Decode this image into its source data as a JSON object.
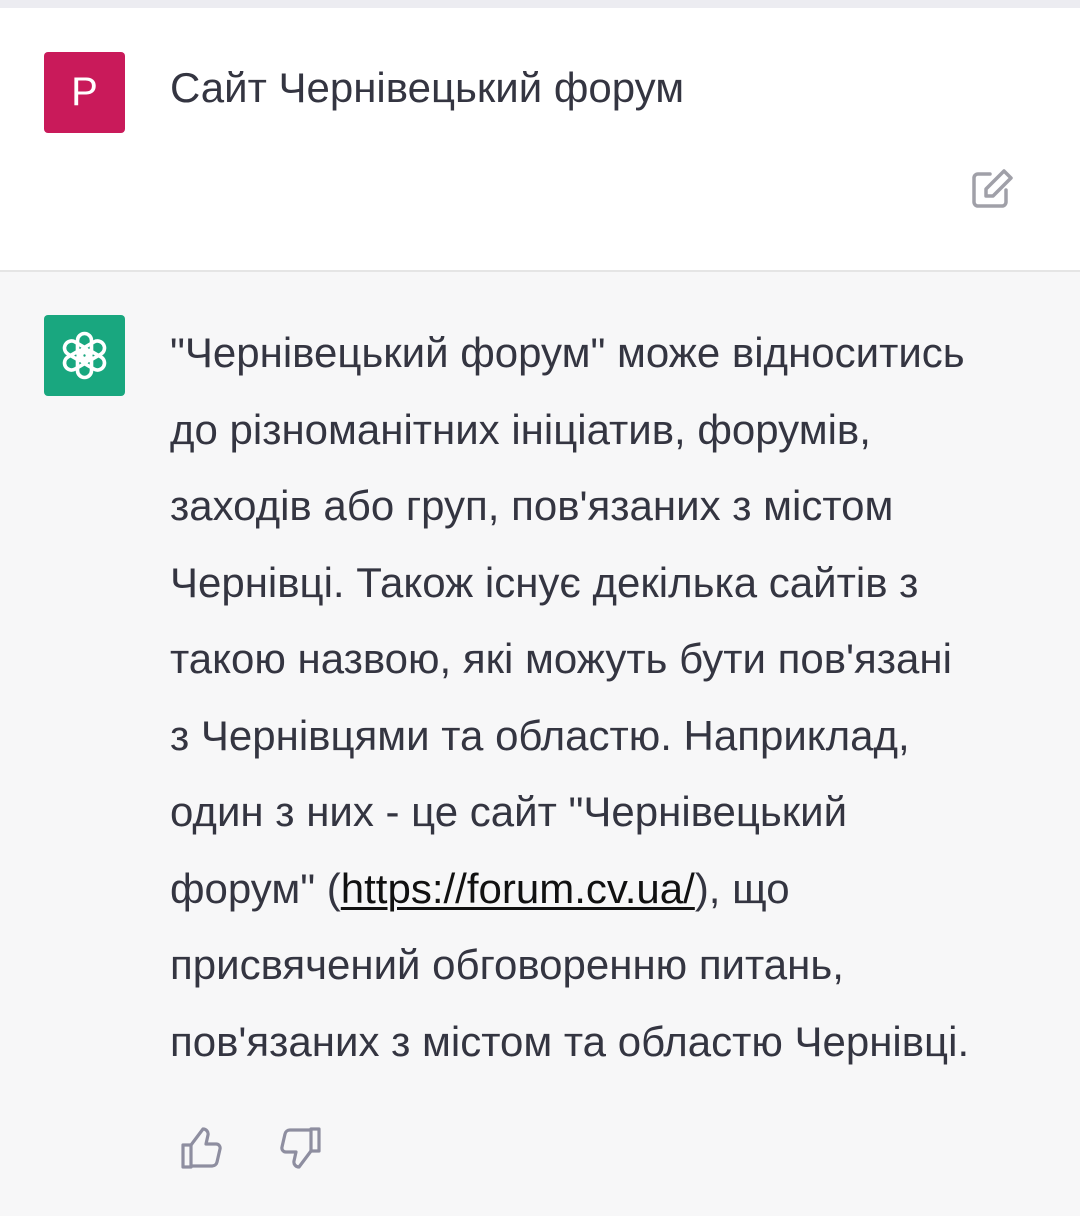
{
  "user_message": {
    "avatar_letter": "P",
    "avatar_color": "#c91a5a",
    "text": "Сайт Чернівецький форум",
    "edit_icon": "edit-icon"
  },
  "assistant_message": {
    "avatar_icon": "openai-logo-icon",
    "avatar_color": "#19a77f",
    "lines": [
      "\"Чернівецький форум\" може відноситись",
      "до різноманітних ініціатив, форумів,",
      "заходів або груп, пов'язаних з містом",
      "Чернівці. Також існує декілька сайтів з",
      "такою назвою, які можуть бути пов'язані",
      "з Чернівцями та областю. Наприклад,",
      "один з них - це сайт \"Чернівецький"
    ],
    "link_line_before": "форум\" (",
    "link_text": "https://forum.cv.ua/",
    "link_line_after": "), що",
    "lines_after": [
      "присвячений обговоренню питань,",
      "пов'язаних з містом та областю Чернівці."
    ]
  },
  "feedback": {
    "like_icon": "thumbs-up-icon",
    "dislike_icon": "thumbs-down-icon"
  }
}
